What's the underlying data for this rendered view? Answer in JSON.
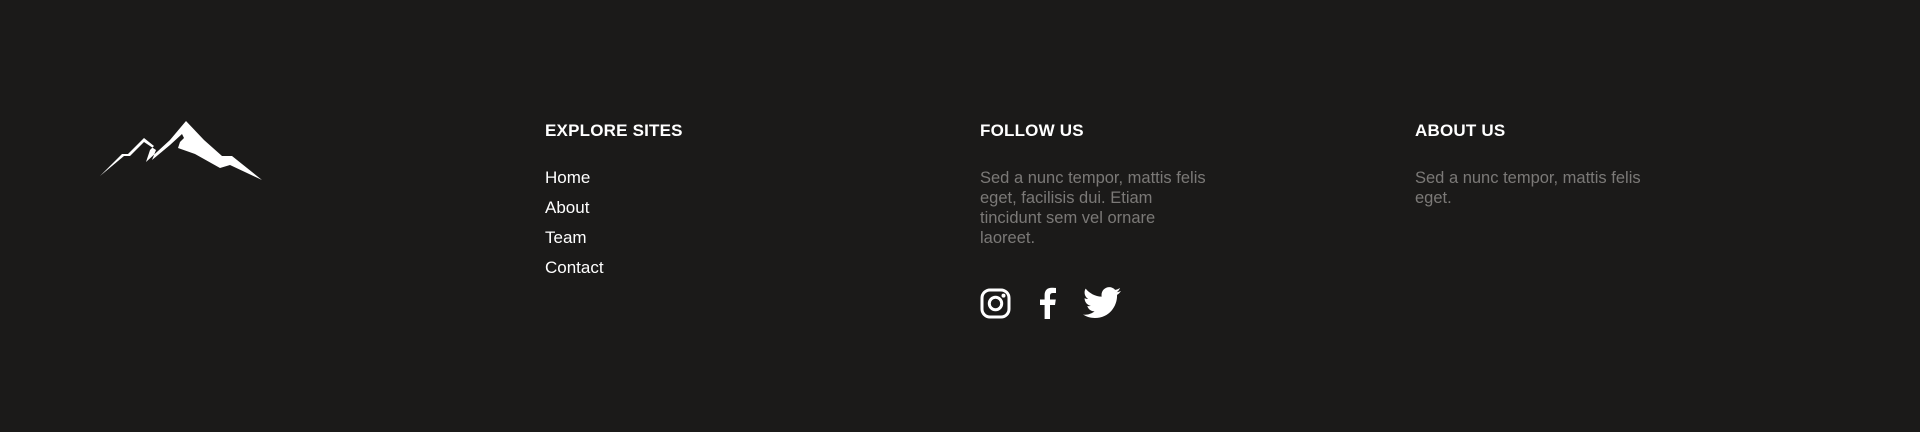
{
  "brand": {
    "logo_icon": "mountain-icon"
  },
  "explore": {
    "heading": "EXPLORE SITES",
    "links": [
      {
        "label": "Home"
      },
      {
        "label": "About"
      },
      {
        "label": "Team"
      },
      {
        "label": "Contact"
      }
    ]
  },
  "follow": {
    "heading": "FOLLOW US",
    "text": "Sed a nunc tempor, mattis felis eget, facilisis dui. Etiam tincidunt sem vel ornare laoreet.",
    "social": [
      {
        "icon": "instagram-icon"
      },
      {
        "icon": "facebook-icon"
      },
      {
        "icon": "twitter-icon"
      }
    ]
  },
  "about": {
    "heading": "ABOUT US",
    "text": "Sed a nunc tempor, mattis felis eget."
  },
  "colors": {
    "background": "#1b1a19",
    "heading": "#ffffff",
    "link": "#ffffff",
    "muted_text": "#7b7977"
  }
}
